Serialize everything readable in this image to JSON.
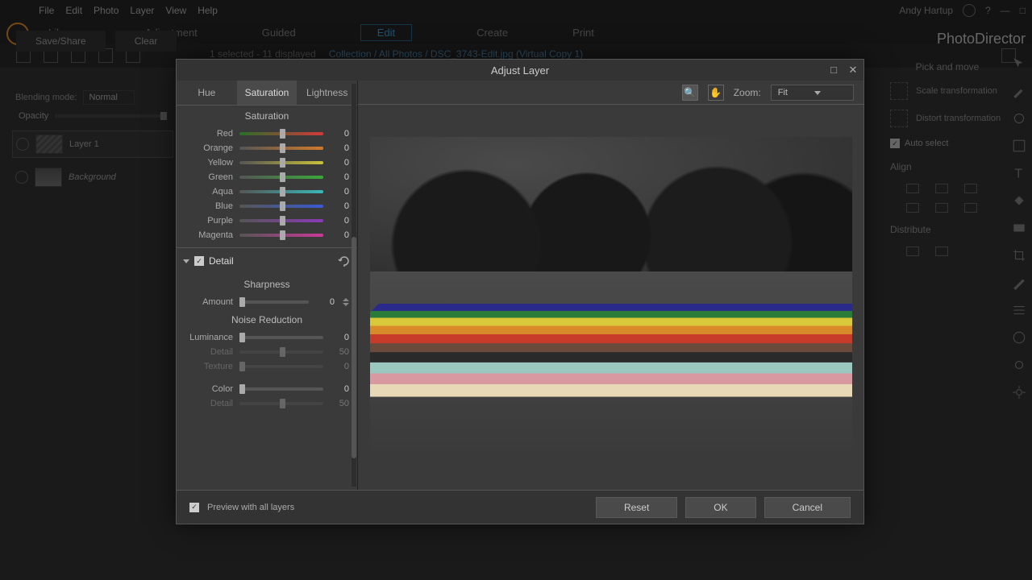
{
  "menus": [
    "File",
    "Edit",
    "Photo",
    "Layer",
    "View",
    "Help"
  ],
  "user": "Andy Hartup",
  "brand": "PhotoDirector",
  "modes": {
    "items": [
      "Library",
      "Adjustment",
      "Guided",
      "Edit",
      "Create",
      "Print"
    ],
    "active": "Edit"
  },
  "leftPanel": {
    "blendLabel": "Blending mode:",
    "blendValue": "Normal",
    "opacityLabel": "Opacity",
    "layers": [
      {
        "name": "Layer 1"
      },
      {
        "name": "Background"
      }
    ],
    "save": "Save/Share",
    "clear": "Clear"
  },
  "rightPanel": {
    "header": "Pick and move",
    "tools": [
      {
        "name": "Scale transformation"
      },
      {
        "name": "Distort transformation"
      }
    ],
    "autoSelect": "Auto select",
    "align": "Align",
    "distribute": "Distribute"
  },
  "footer": {
    "status": "1 selected - 11 displayed",
    "path": "Collection / All Photos / DSC_3743-Edit.jpg (Virtual Copy 1)"
  },
  "dialog": {
    "title": "Adjust Layer",
    "tabs": [
      "Hue",
      "Saturation",
      "Lightness"
    ],
    "activeTab": "Saturation",
    "satLabel": "Saturation",
    "colors": [
      {
        "name": "Red",
        "grad": "linear-gradient(90deg,#2a6e2a,#d13a3a)",
        "val": "0"
      },
      {
        "name": "Orange",
        "grad": "linear-gradient(90deg,#555,#d17a2a)",
        "val": "0"
      },
      {
        "name": "Yellow",
        "grad": "linear-gradient(90deg,#555,#c8c23a)",
        "val": "0"
      },
      {
        "name": "Green",
        "grad": "linear-gradient(90deg,#555,#3aa83a)",
        "val": "0"
      },
      {
        "name": "Aqua",
        "grad": "linear-gradient(90deg,#555,#3ab8b8)",
        "val": "0"
      },
      {
        "name": "Blue",
        "grad": "linear-gradient(90deg,#555,#3a5ad1)",
        "val": "0"
      },
      {
        "name": "Purple",
        "grad": "linear-gradient(90deg,#555,#8a3ab8)",
        "val": "0"
      },
      {
        "name": "Magenta",
        "grad": "linear-gradient(90deg,#555,#c83a98)",
        "val": "0"
      }
    ],
    "detail": "Detail",
    "sharpness": "Sharpness",
    "amount": {
      "label": "Amount",
      "val": "0"
    },
    "noise": "Noise Reduction",
    "luminance": {
      "label": "Luminance",
      "val": "0"
    },
    "ldetail": {
      "label": "Detail",
      "val": "50"
    },
    "texture": {
      "label": "Texture",
      "val": "0"
    },
    "color": {
      "label": "Color",
      "val": "0"
    },
    "cdetail": {
      "label": "Detail",
      "val": "50"
    },
    "zoom": "Zoom:",
    "zoomVal": "Fit",
    "preview": "Preview with all layers",
    "reset": "Reset",
    "ok": "OK",
    "cancel": "Cancel",
    "stripes": [
      "#2a2a8a",
      "#2a7a3a",
      "#d8c83a",
      "#d88a2a",
      "#c83a2a",
      "#6a4a3a",
      "#2a2a2a",
      "#9ac8c0",
      "#d89aa0",
      "#e8d8b8"
    ]
  }
}
